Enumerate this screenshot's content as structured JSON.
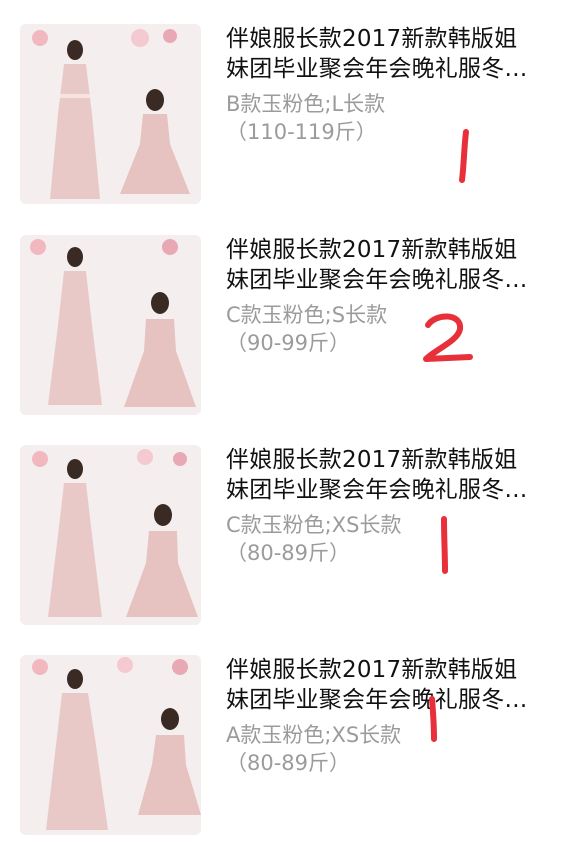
{
  "items": [
    {
      "title_line1": "伴娘服长款2017新款韩版姐",
      "title_line2": "妹团毕业聚会年会晚礼服冬…",
      "variant_line1": "B款玉粉色;L长款",
      "variant_line2": "（110-119斤）",
      "mark": "1"
    },
    {
      "title_line1": "伴娘服长款2017新款韩版姐",
      "title_line2": "妹团毕业聚会年会晚礼服冬…",
      "variant_line1": "C款玉粉色;S长款",
      "variant_line2": "（90-99斤）",
      "mark": "2"
    },
    {
      "title_line1": "伴娘服长款2017新款韩版姐",
      "title_line2": "妹团毕业聚会年会晚礼服冬…",
      "variant_line1": "C款玉粉色;XS长款",
      "variant_line2": "（80-89斤）",
      "mark": "1"
    },
    {
      "title_line1": "伴娘服长款2017新款韩版姐",
      "title_line2": "妹团毕业聚会年会晚礼服冬…",
      "variant_line1": "A款玉粉色;XS长款",
      "variant_line2": "（80-89斤）",
      "mark": "1"
    }
  ],
  "colors": {
    "title": "#111111",
    "variant": "#9b9b9b",
    "annotation": "#e8303a",
    "dress": "#e9c9c7",
    "thumb_bg": "#f5eeee"
  }
}
